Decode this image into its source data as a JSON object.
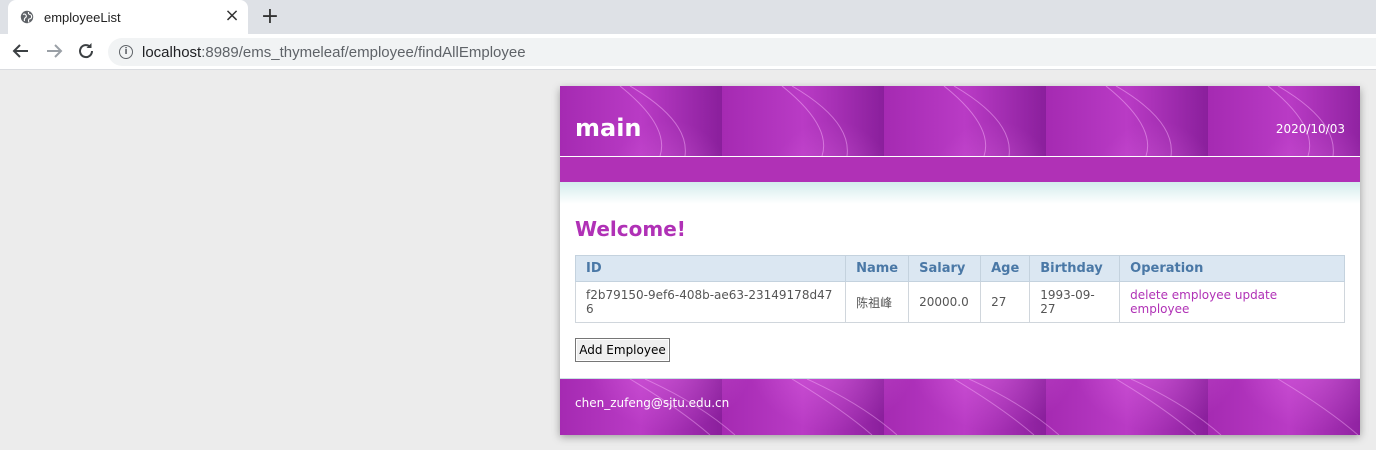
{
  "browser": {
    "tab_title": "employeeList",
    "tab_close_icon": "close-icon",
    "new_tab_icon": "plus-icon",
    "url_host": "localhost",
    "url_path": ":8989/ems_thymeleaf/employee/findAllEmployee"
  },
  "header": {
    "title": "main",
    "date": "2020/10/03"
  },
  "content": {
    "heading": "Welcome!",
    "table": {
      "columns": [
        "ID",
        "Name",
        "Salary",
        "Age",
        "Birthday",
        "Operation"
      ],
      "rows": [
        {
          "id": "f2b79150-9ef6-408b-ae63-23149178d476",
          "name": "陈祖峰",
          "salary": "20000.0",
          "age": "27",
          "birthday": "1993-09-27",
          "delete_label": "delete employee",
          "update_label": "update employee"
        }
      ]
    },
    "add_button_label": "Add Employee"
  },
  "footer": {
    "email": "chen_zufeng@sjtu.edu.cn"
  },
  "colors": {
    "accent": "#b031b6",
    "header_text": "#4a78a6",
    "header_bg": "#dbe7f2"
  }
}
